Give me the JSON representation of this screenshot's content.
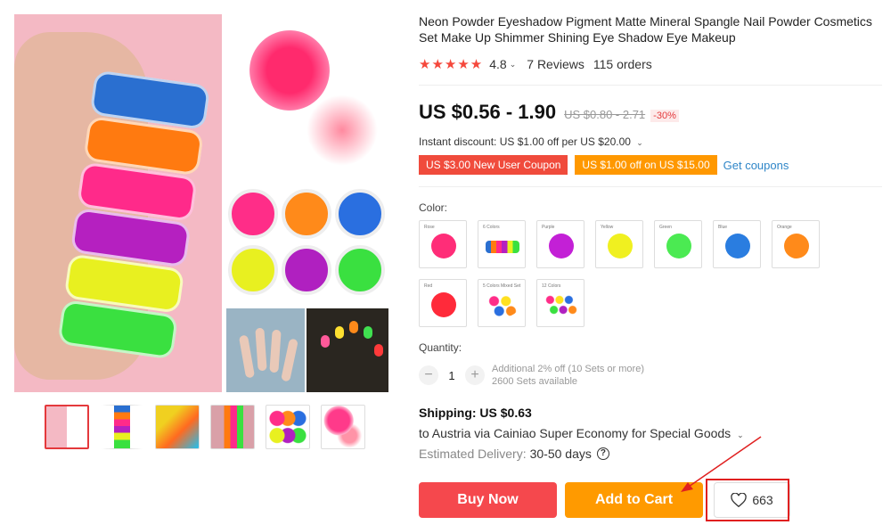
{
  "product": {
    "title": "Neon Powder Eyeshadow Pigment Matte Mineral Spangle Nail Powder Cosmetics Set Make Up Shimmer Shining Eye Shadow Eye Makeup",
    "stars": "★★★★★",
    "rating": "4.8",
    "reviews": "7 Reviews",
    "orders": "115 orders"
  },
  "pricing": {
    "price": "US $0.56 - 1.90",
    "original_price": "US $0.80 - 2.71",
    "discount": "-30%",
    "instant_discount": "Instant discount: US $1.00 off per US $20.00"
  },
  "coupons": {
    "new_user": "US $3.00 New User Coupon",
    "store": "US $1.00 off on US $15.00",
    "get_coupons": "Get coupons"
  },
  "color": {
    "label": "Color:",
    "options": [
      {
        "label": "Rose",
        "color": "#ff2d78"
      },
      {
        "label": "6 Colors",
        "color": "#c8d0d8"
      },
      {
        "label": "Purple",
        "color": "#c320d6"
      },
      {
        "label": "Yellow",
        "color": "#f0f020"
      },
      {
        "label": "Green",
        "color": "#4bea52"
      },
      {
        "label": "Blue",
        "color": "#2a7de0"
      },
      {
        "label": "Orange",
        "color": "#ff8a1a"
      },
      {
        "label": "Red",
        "color": "#ff2a3a"
      },
      {
        "label": "5 Colors Mixed Set",
        "color": "#ff5ab0"
      },
      {
        "label": "12 Colors",
        "color": "#f0b0e0"
      }
    ]
  },
  "quantity": {
    "label": "Quantity:",
    "minus": "−",
    "plus": "+",
    "value": "1",
    "note_discount": "Additional 2% off (10 Sets or more)",
    "note_available": "2600 Sets available"
  },
  "shipping": {
    "cost": "Shipping: US $0.63",
    "to": "to Austria via Cainiao Super Economy for Special Goods",
    "delivery_label": "Estimated Delivery:",
    "delivery_days": "30-50 days"
  },
  "actions": {
    "buy_now": "Buy Now",
    "add_to_cart": "Add to Cart",
    "wishlist_count": "663"
  },
  "gallery": {
    "jar_colors": [
      "#2a6fd0",
      "#ff7a10",
      "#ff2a8a",
      "#b520c0",
      "#e8f020",
      "#3ae040"
    ],
    "grid_colors": [
      "#ff2d88",
      "#ff8a1a",
      "#2a6fe0",
      "#e8f020",
      "#b020c0",
      "#3ae040"
    ]
  },
  "colors": {
    "accent_red": "#f5484d",
    "accent_orange": "#ff9a00",
    "link_blue": "#2f86c8",
    "annotation_red": "#e02020"
  }
}
